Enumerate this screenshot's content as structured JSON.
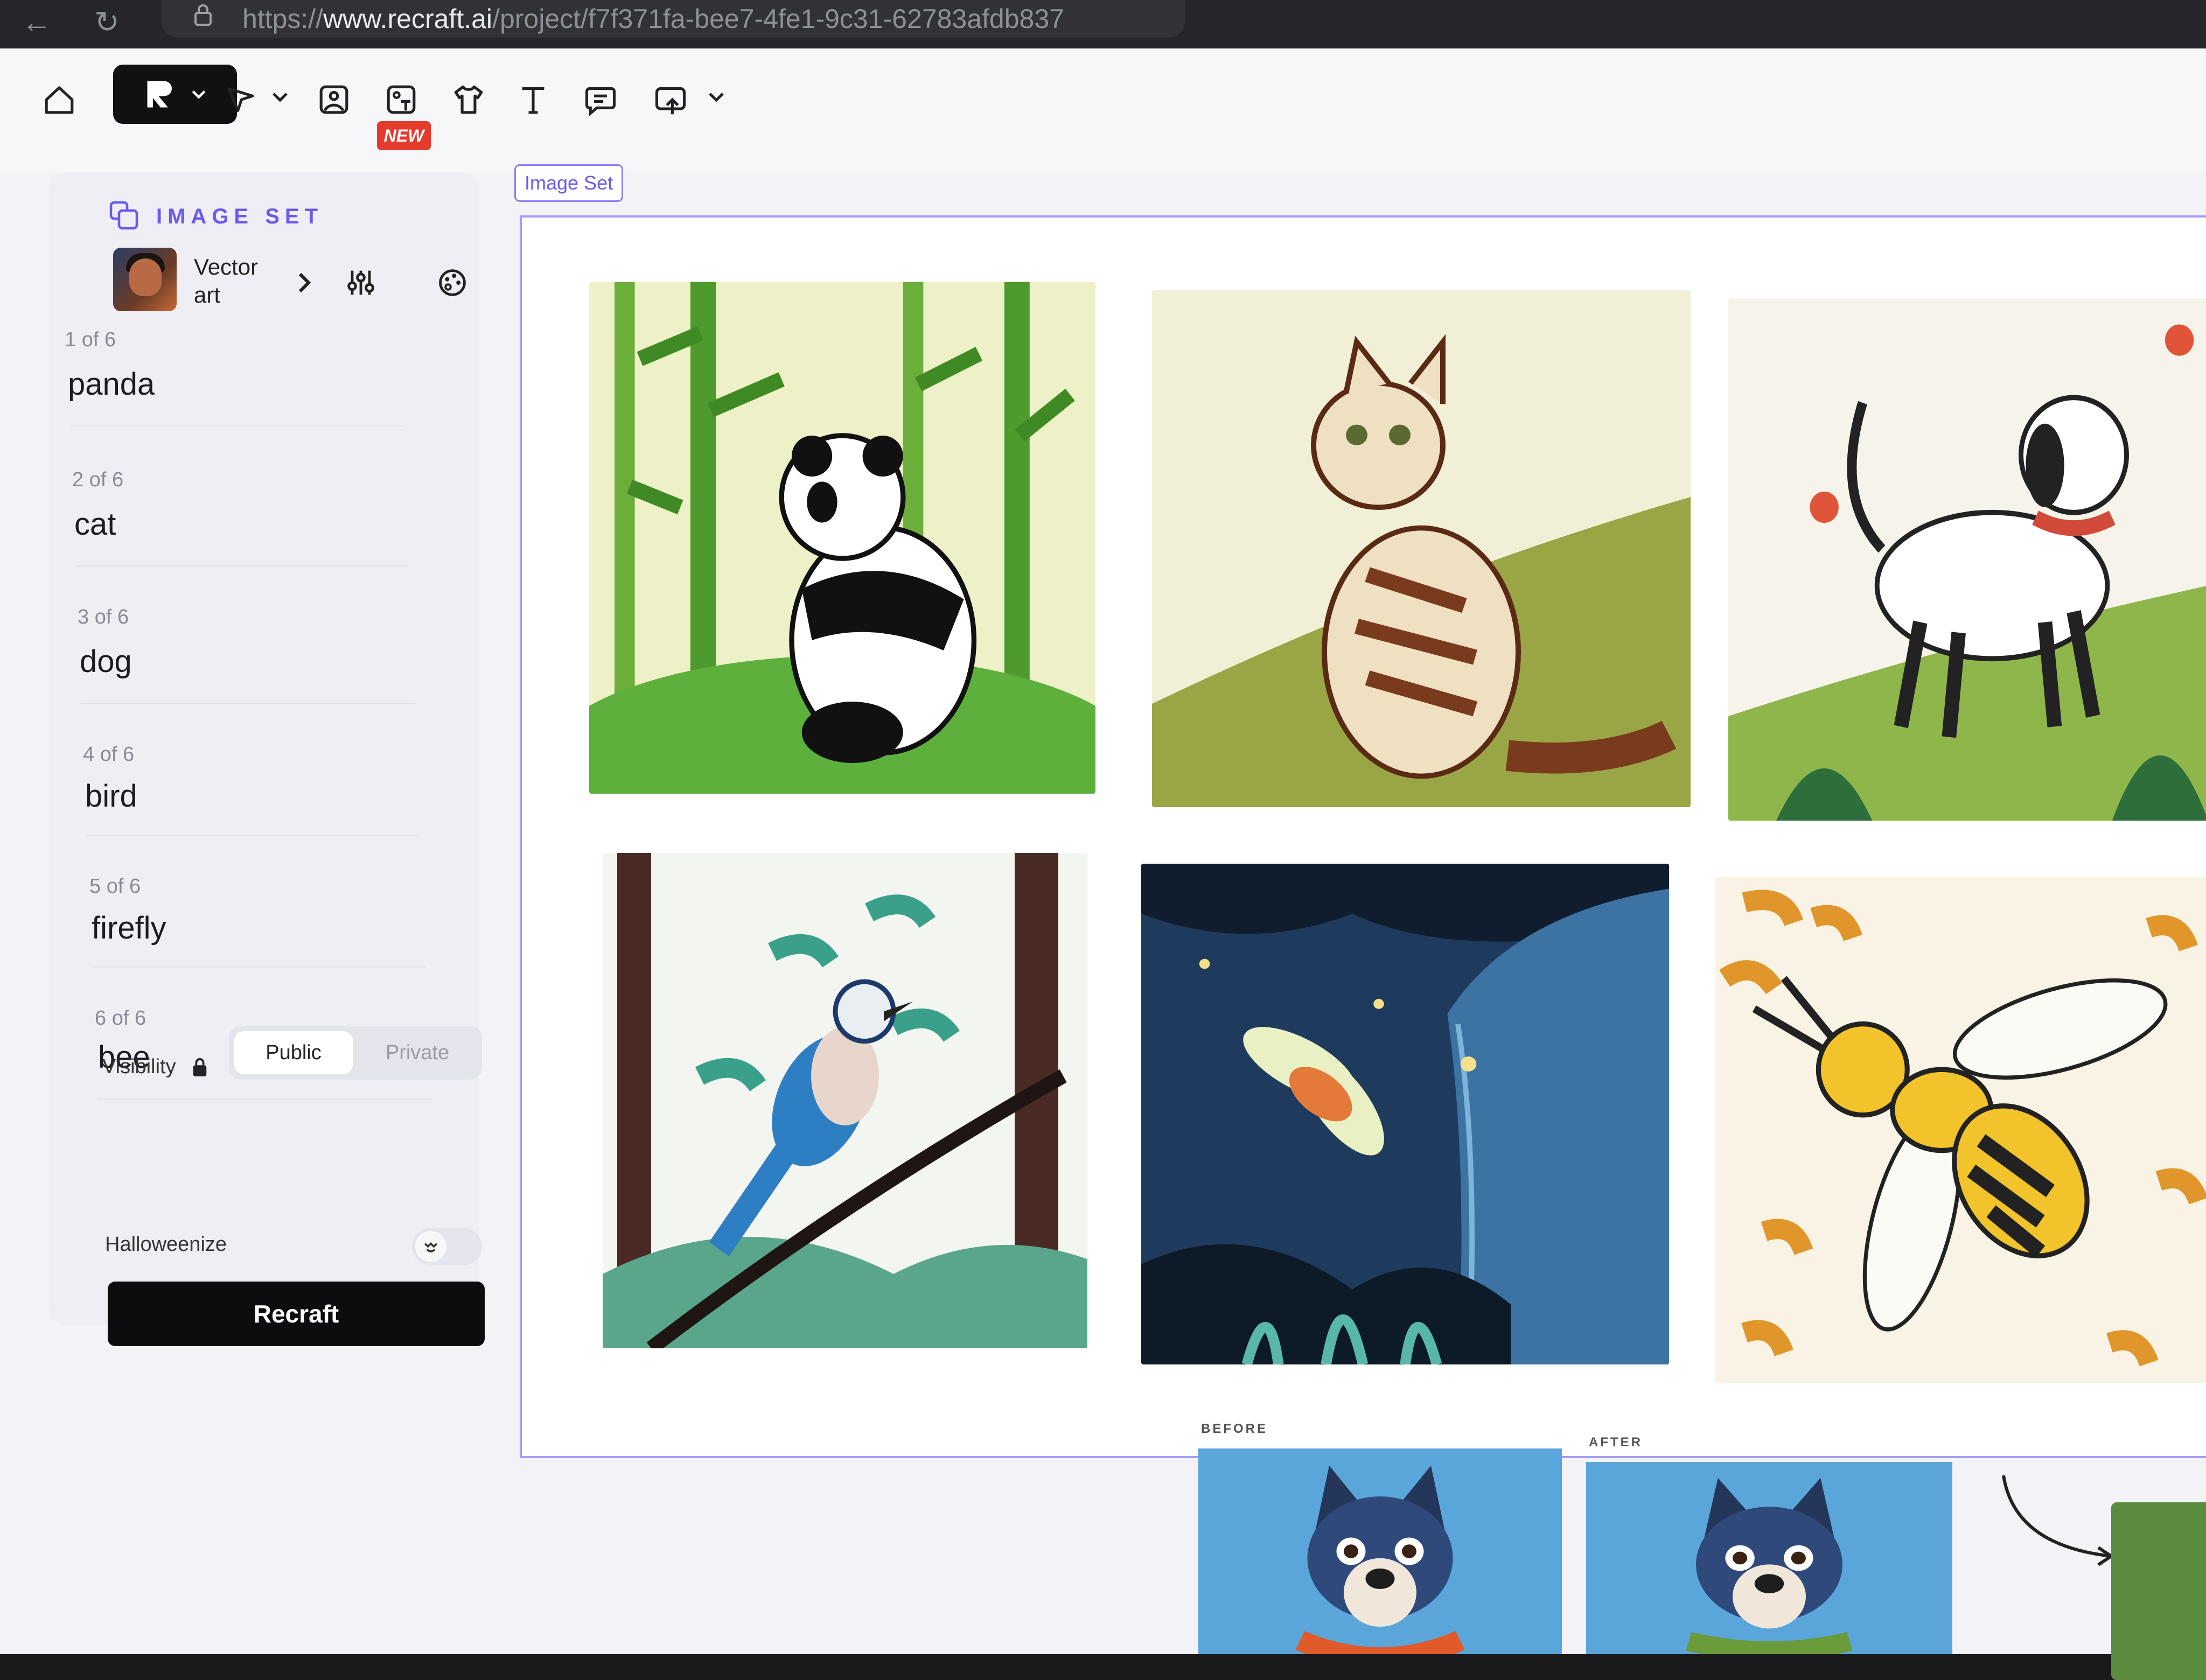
{
  "browser": {
    "url_scheme": "https://",
    "url_host": "www.recraft.ai",
    "url_path": "/project/f7f371fa-bee7-4fe1-9c31-62783afdb837"
  },
  "toolbar": {
    "new_badge": "NEW"
  },
  "panel": {
    "title": "IMAGE SET",
    "style_name": "Vector art",
    "prompts": [
      {
        "count": "1 of 6",
        "text": "panda"
      },
      {
        "count": "2 of 6",
        "text": "cat"
      },
      {
        "count": "3 of 6",
        "text": "dog"
      },
      {
        "count": "4 of 6",
        "text": "bird"
      },
      {
        "count": "5 of 6",
        "text": "firefly"
      },
      {
        "count": "6 of 6",
        "text": "bee"
      }
    ],
    "visibility_label": "Visibility",
    "visibility_options": [
      "Public",
      "Private"
    ],
    "visibility_selected": "Public",
    "halloweenize_label": "Halloweenize",
    "recraft_button": "Recraft"
  },
  "canvas": {
    "set_tag": "Image Set",
    "before_label": "BEFORE",
    "after_label": "AFTER"
  },
  "colors": {
    "accent": "#6a5af0",
    "badge": "#e53b2c",
    "primary_button": "#0d0d0f"
  }
}
